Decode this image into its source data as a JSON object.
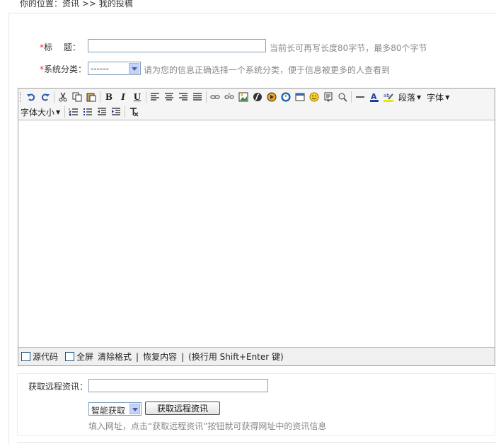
{
  "breadcrumb": "你的位置：资讯 >> 我的投稿",
  "form": {
    "title_label_star": "*",
    "title_label": "标　 题：",
    "title_value": "",
    "title_hint": "当前长可再写长度80字节，最多80个字节",
    "category_label_star": "*",
    "category_label": "系统分类：",
    "category_value": "------",
    "category_hint": "请为您的信息正确选择一个系统分类，便于信息被更多的人查看到"
  },
  "editor": {
    "toolbar": {
      "bold": "B",
      "italic": "I",
      "underline": "U",
      "paragraph_label": "段落",
      "font_label": "字体",
      "font_size_label": "字体大小"
    },
    "status": {
      "source_label": "源代码",
      "fullscreen_label": "全屏",
      "clear_format_label": "清除格式",
      "sep1": "|",
      "restore_label": "恢复内容",
      "sep2": "|",
      "hint": "(换行用 Shift+Enter 键)"
    }
  },
  "remote": {
    "label": "获取远程资讯：",
    "input_value": "",
    "mode_value": "智能获取",
    "button_label": "获取远程资讯",
    "hint": "填入网址，点击“获取远程资讯”按钮就可获得网址中的资讯信息"
  },
  "colors": {
    "required": "#ee3333",
    "hint": "#888888",
    "border": "#7f9db9"
  }
}
